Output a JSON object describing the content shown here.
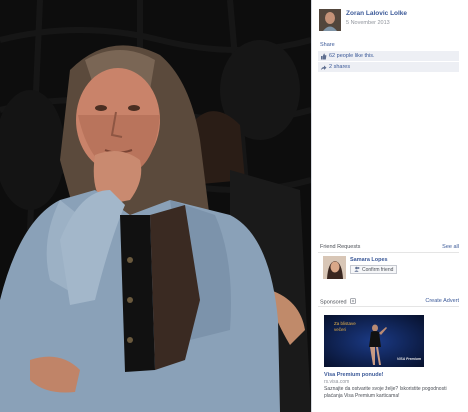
{
  "post": {
    "author_name": "Zoran Lalovic Lolke",
    "date": "5 November 2013",
    "share_label": "Share",
    "likes_text": "62 people like this.",
    "shares_text": "2 shares"
  },
  "friend_requests": {
    "header": "Friend Requests",
    "see_all": "See all",
    "items": [
      {
        "name": "Samara Lopes",
        "confirm_label": "Confirm friend"
      }
    ]
  },
  "sponsored": {
    "header": "Sponsored",
    "create_advert": "Create Advert",
    "ad": {
      "image_text_line1": "Za blistave",
      "image_text_line2": "večeri",
      "image_logo": "VISA Premium",
      "title": "Visa Premium ponude!",
      "domain": "rs.visa.com",
      "body": "Saznajte da ostvarite svoje želje? Iskoristite pogodnosti plaćanja Visa Premium karticama!"
    }
  },
  "colors": {
    "link": "#3b5998",
    "muted": "#90949c",
    "stat_bg": "#edeff4",
    "photo_bg": "#0b0b0b"
  },
  "icons": {
    "like": "thumbs-up-icon",
    "share": "share-arrow-icon",
    "sponsored": "sponsored-icon"
  }
}
